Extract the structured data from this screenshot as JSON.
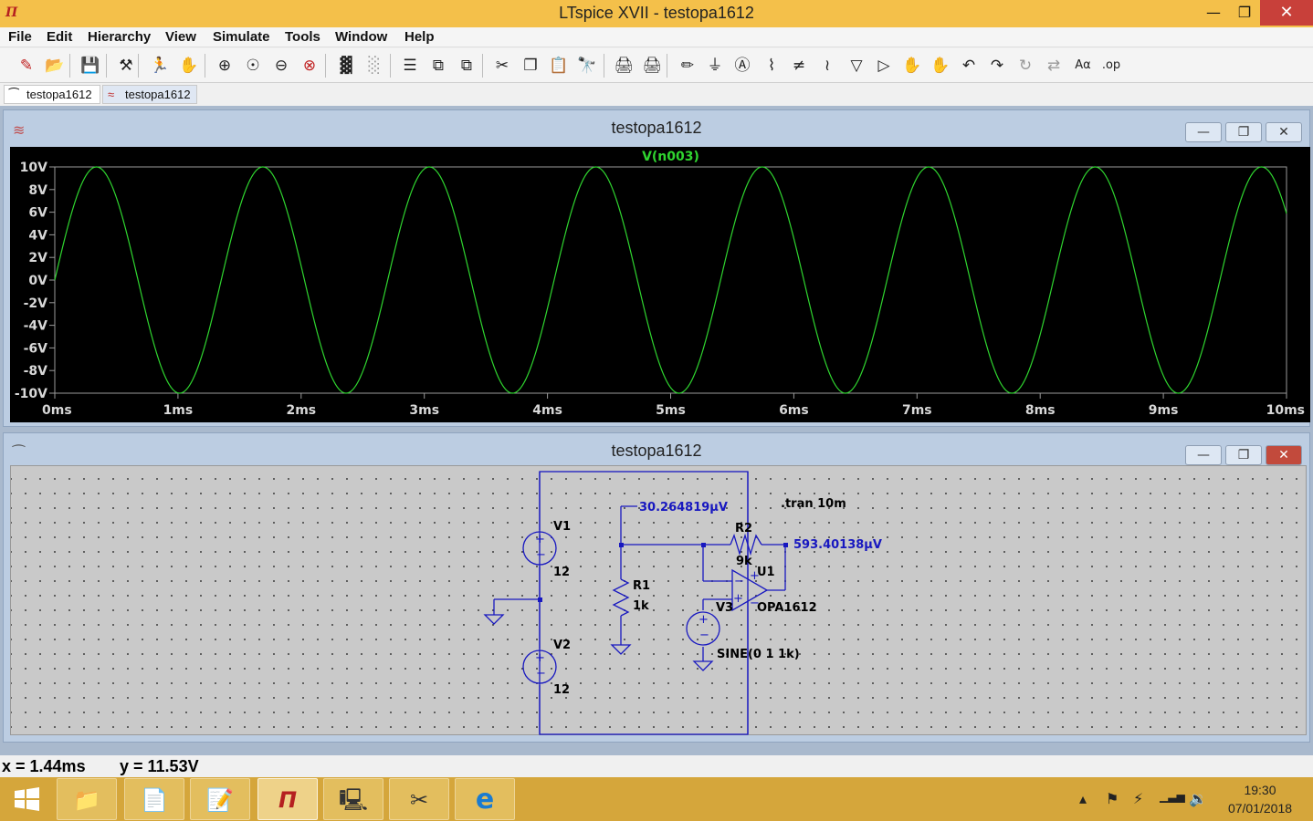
{
  "window": {
    "title": "LTspice XVII - testopa1612",
    "logo_glyph": "Π",
    "min_glyph": "—",
    "max_glyph": "❐",
    "close_glyph": "✕"
  },
  "menu": [
    "File",
    "Edit",
    "Hierarchy",
    "View",
    "Simulate",
    "Tools",
    "Window",
    "Help"
  ],
  "toolbar_icons": [
    {
      "name": "new-schematic-icon",
      "glyph": "✎"
    },
    {
      "name": "open-icon",
      "glyph": "📂"
    },
    {
      "name": "save-icon",
      "glyph": "💾"
    },
    {
      "name": "control-panel-icon",
      "glyph": "⚒"
    },
    {
      "name": "run-icon",
      "glyph": "🏃"
    },
    {
      "name": "halt-icon",
      "glyph": "✋"
    },
    {
      "name": "zoom-in-icon",
      "glyph": "⊕"
    },
    {
      "name": "zoom-pan-icon",
      "glyph": "☉"
    },
    {
      "name": "zoom-out-icon",
      "glyph": "⊖"
    },
    {
      "name": "zoom-fit-icon",
      "glyph": "⊗"
    },
    {
      "name": "autorange-icon",
      "glyph": "▓"
    },
    {
      "name": "autorange-dim-icon",
      "glyph": "░"
    },
    {
      "name": "tile-horizontal-icon",
      "glyph": "☰"
    },
    {
      "name": "cascade-icon",
      "glyph": "⧉"
    },
    {
      "name": "tile-vertical-icon",
      "glyph": "⧉"
    },
    {
      "name": "cut-icon",
      "glyph": "✂"
    },
    {
      "name": "copy-icon",
      "glyph": "❐"
    },
    {
      "name": "paste-icon",
      "glyph": "📋"
    },
    {
      "name": "find-icon",
      "glyph": "🔭"
    },
    {
      "name": "print-icon",
      "glyph": "🖨"
    },
    {
      "name": "print-setup-icon",
      "glyph": "🖨"
    },
    {
      "name": "draw-wire-icon",
      "glyph": "✏"
    },
    {
      "name": "ground-icon",
      "glyph": "⏚"
    },
    {
      "name": "label-net-icon",
      "glyph": "Ⓐ"
    },
    {
      "name": "resistor-icon",
      "glyph": "⌇"
    },
    {
      "name": "capacitor-icon",
      "glyph": "≠"
    },
    {
      "name": "inductor-icon",
      "glyph": "≀"
    },
    {
      "name": "diode-icon",
      "glyph": "▽"
    },
    {
      "name": "component-icon",
      "glyph": "▷"
    },
    {
      "name": "move-icon",
      "glyph": "✋"
    },
    {
      "name": "drag-icon",
      "glyph": "✋"
    },
    {
      "name": "undo-icon",
      "glyph": "↶"
    },
    {
      "name": "redo-icon",
      "glyph": "↷"
    },
    {
      "name": "rotate-icon",
      "glyph": "↻"
    },
    {
      "name": "mirror-icon",
      "glyph": "⇄"
    },
    {
      "name": "text-icon",
      "glyph": "Aα"
    },
    {
      "name": "spice-directive-icon",
      "glyph": ".op"
    }
  ],
  "tabs": [
    {
      "label": "testopa1612",
      "icon": "schematic-icon",
      "glyph": "⁀"
    },
    {
      "label": "testopa1612",
      "icon": "waveform-icon",
      "glyph": "≈"
    }
  ],
  "plot_window": {
    "title": "testopa1612",
    "icon_glyph": "≋",
    "min_glyph": "—",
    "max_glyph": "❐",
    "close_glyph": "✕"
  },
  "schematic_window": {
    "title": "testopa1612",
    "icon_glyph": "⁀",
    "min_glyph": "—",
    "max_glyph": "❐",
    "close_glyph": "✕"
  },
  "chart_data": {
    "type": "line",
    "title": "V(n003)",
    "series": [
      {
        "name": "V(n003)",
        "color": "#2fd52f",
        "amplitude": 10,
        "frequency_khz": 0.74,
        "offset": 0
      }
    ],
    "x_ticks": [
      "0ms",
      "1ms",
      "2ms",
      "3ms",
      "4ms",
      "5ms",
      "6ms",
      "7ms",
      "8ms",
      "9ms",
      "10ms"
    ],
    "y_ticks": [
      "10V",
      "8V",
      "6V",
      "4V",
      "2V",
      "0V",
      "-2V",
      "-4V",
      "-6V",
      "-8V",
      "-10V"
    ],
    "xlim": [
      0,
      10
    ],
    "ylim": [
      -10,
      10
    ],
    "xlabel": "",
    "ylabel": "",
    "background": "#000000",
    "grid": false
  },
  "schematic": {
    "v1_name": "V1",
    "v1_value": "12",
    "v2_name": "V2",
    "v2_value": "12",
    "v3_name": "V3",
    "v3_value": "SINE(0 1 1k)",
    "r1_name": "R1",
    "r1_value": "1k",
    "r2_name": "R2",
    "r2_value": "9k",
    "u1_name": "U1",
    "u1_value": "OPA1612",
    "directive": ".tran 10m",
    "node_voltage_1": "30.264819µV",
    "node_voltage_2": "593.40138µV",
    "wire_color": "#1818c0"
  },
  "status": {
    "x": "x = 1.44ms",
    "y": "y = 11.53V"
  },
  "taskbar": {
    "apps": [
      {
        "name": "file-explorer-icon",
        "glyph": "📁"
      },
      {
        "name": "notepad-icon",
        "glyph": "📄"
      },
      {
        "name": "notes-icon",
        "glyph": "📝"
      },
      {
        "name": "ltspice-icon",
        "glyph": "Π"
      },
      {
        "name": "calculator-icon",
        "glyph": "🖳"
      },
      {
        "name": "snipping-tool-icon",
        "glyph": "✂"
      },
      {
        "name": "internet-explorer-icon",
        "glyph": "e"
      }
    ],
    "tray": [
      {
        "name": "tray-up-arrow-icon",
        "glyph": "▴"
      },
      {
        "name": "flag-icon",
        "glyph": "⚑"
      },
      {
        "name": "power-icon",
        "glyph": "⚡"
      },
      {
        "name": "network-icon",
        "glyph": "▁▃▅"
      },
      {
        "name": "volume-icon",
        "glyph": "🔉"
      }
    ],
    "time": "19:30",
    "date": "07/01/2018"
  }
}
